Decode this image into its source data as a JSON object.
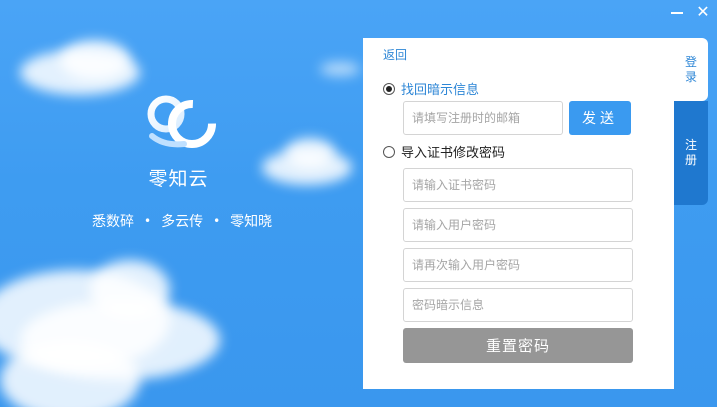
{
  "window": {
    "minimize_symbol": "",
    "close_symbol": "✕"
  },
  "brand": {
    "name": "零知云",
    "tagline": [
      "悉数碎",
      "多云传",
      "零知晓"
    ],
    "separator": "•",
    "logo_icon": "cloud-logo-icon",
    "accent": "#ffffff"
  },
  "panel": {
    "back_label": "返回",
    "option_hint": {
      "label": "找回暗示信息",
      "selected": true,
      "email_placeholder": "请填写注册时的邮箱",
      "send_label": "发送"
    },
    "option_cert": {
      "label": "导入证书修改密码",
      "selected": false,
      "fields": [
        {
          "placeholder": "请输入证书密码"
        },
        {
          "placeholder": "请输入用户密码"
        },
        {
          "placeholder": "请再次输入用户密码"
        },
        {
          "placeholder": "密码暗示信息"
        }
      ]
    },
    "reset_label": "重置密码"
  },
  "side_tabs": {
    "login": {
      "chars": [
        "登",
        "录"
      ]
    },
    "register": {
      "chars": [
        "注",
        "册"
      ]
    }
  },
  "colors": {
    "background": "#3d9df2",
    "link": "#2d86d6",
    "send_button": "#3a9af0",
    "reset_button": "#969696",
    "register_tab": "#1f78cf"
  }
}
